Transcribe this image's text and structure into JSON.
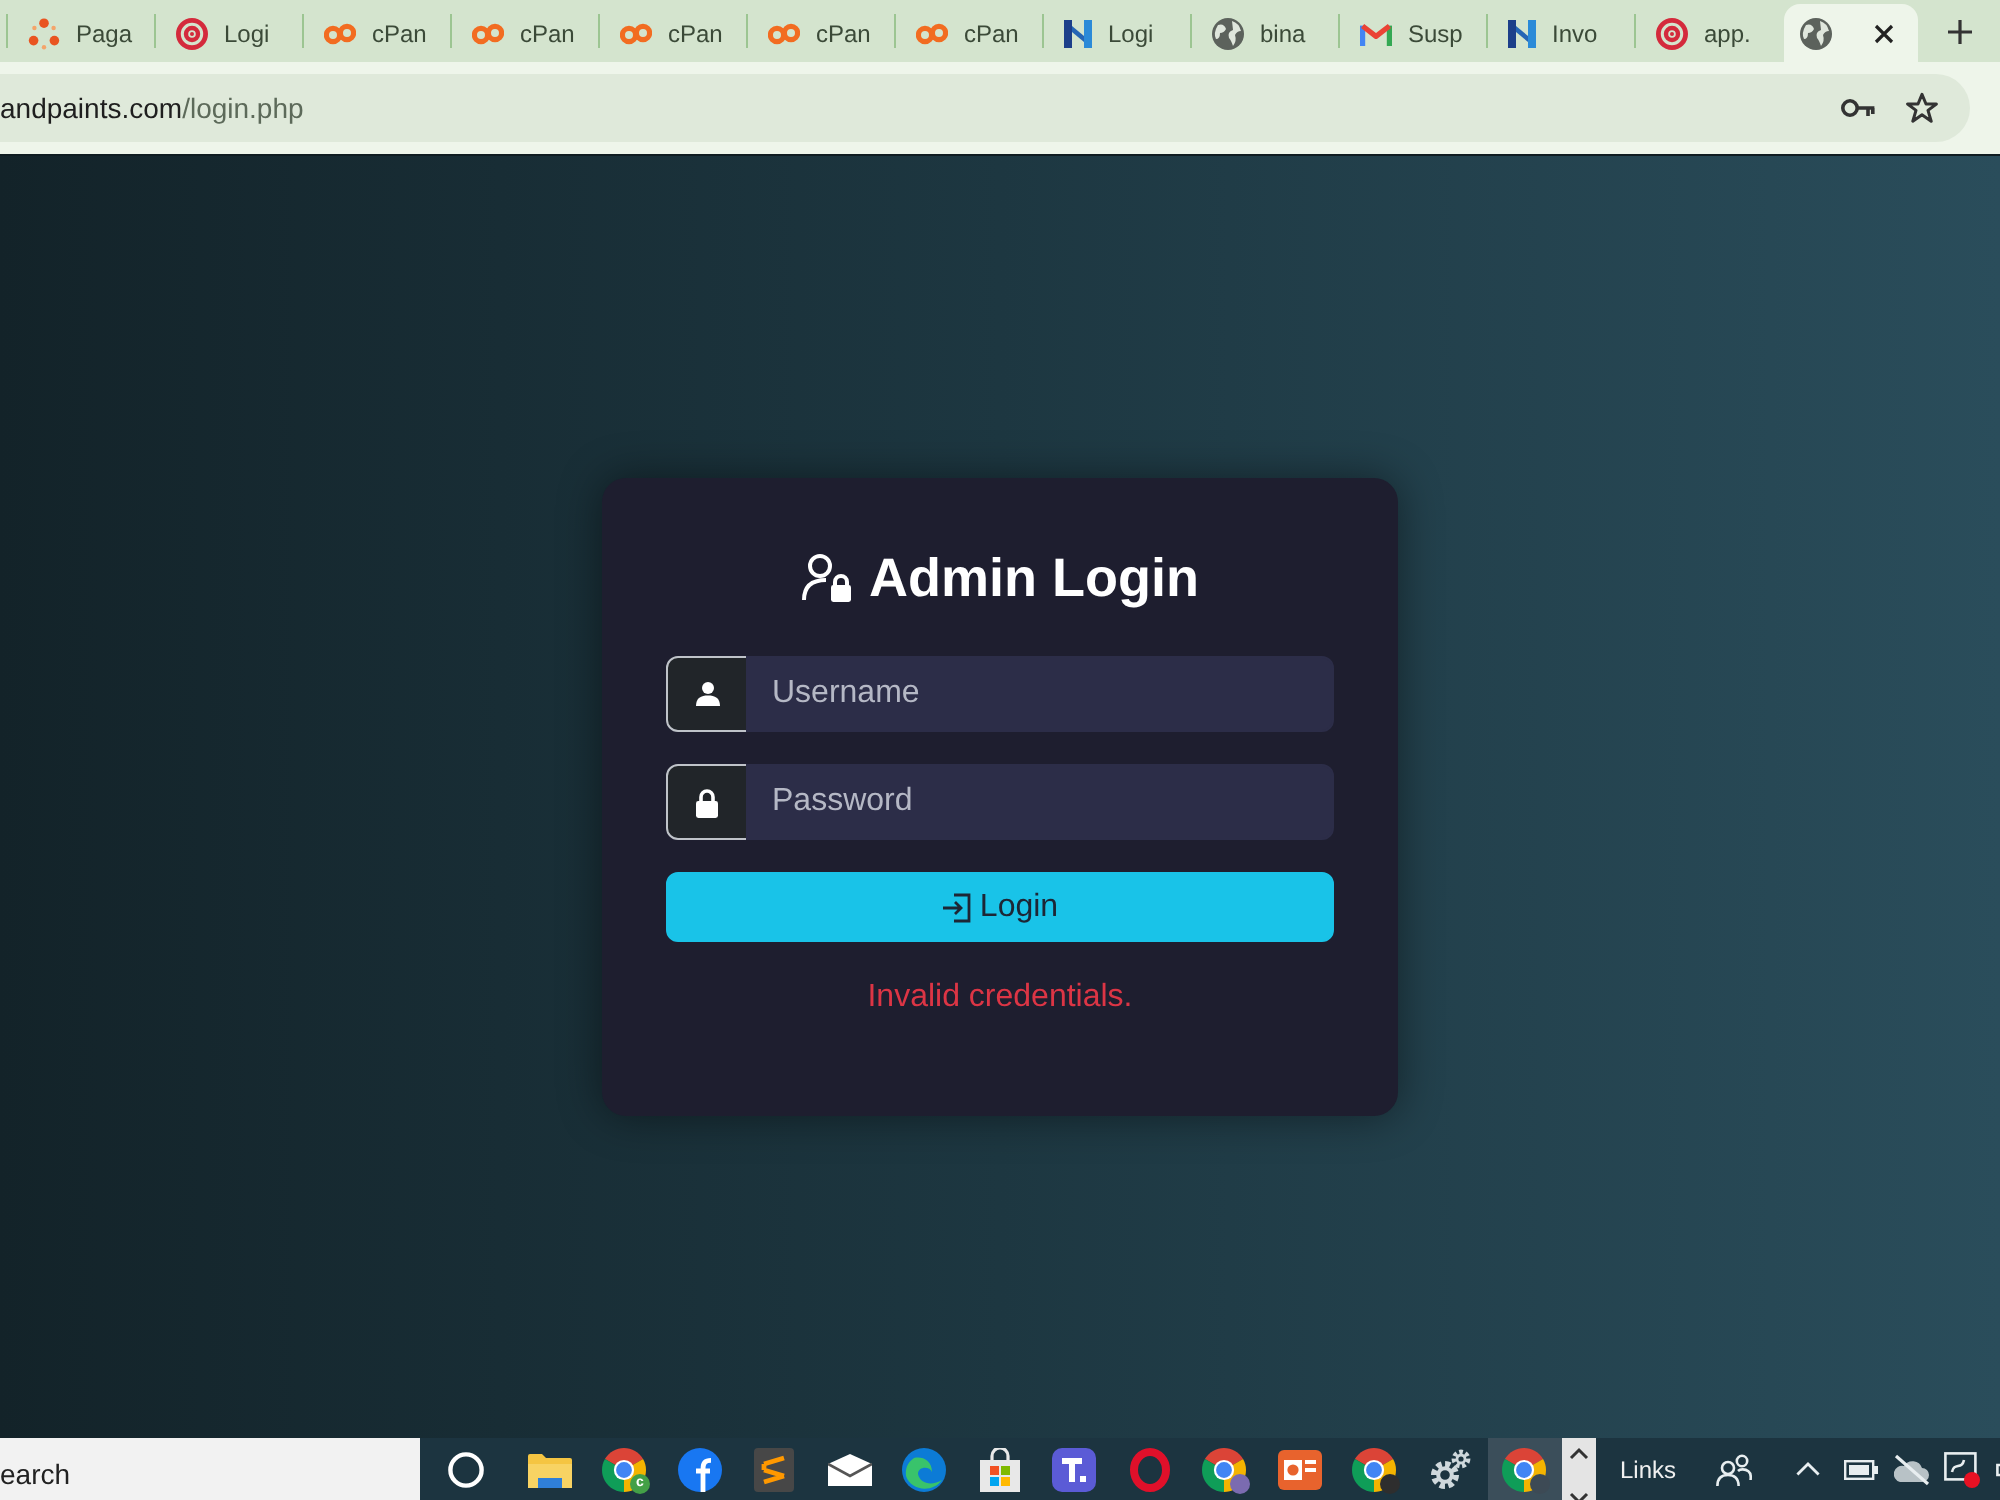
{
  "browser": {
    "tabs": [
      {
        "kind": "dots",
        "title": "Paga",
        "selected": false
      },
      {
        "kind": "target",
        "title": "Logi",
        "selected": false
      },
      {
        "kind": "rings",
        "title": "cPan",
        "selected": false
      },
      {
        "kind": "rings",
        "title": "cPan",
        "selected": false
      },
      {
        "kind": "rings",
        "title": "cPan",
        "selected": false
      },
      {
        "kind": "rings",
        "title": "cPan",
        "selected": false
      },
      {
        "kind": "rings",
        "title": "cPan",
        "selected": false
      },
      {
        "kind": "bars",
        "title": "Logi",
        "selected": false
      },
      {
        "kind": "globe",
        "title": "bina",
        "selected": false
      },
      {
        "kind": "mail",
        "title": "Susp",
        "selected": false
      },
      {
        "kind": "bars",
        "title": "Invo",
        "selected": false
      },
      {
        "kind": "target",
        "title": "app.",
        "selected": false
      },
      {
        "kind": "globe",
        "selected": true
      }
    ],
    "address": {
      "host": "andpaints.com",
      "path": "/login.php"
    }
  },
  "login": {
    "title": "Admin Login",
    "fields": [
      {
        "kind": "username",
        "placeholder": "Username"
      },
      {
        "kind": "password",
        "placeholder": "Password"
      }
    ],
    "button": "Login",
    "error": "Invalid credentials."
  },
  "taskbar": {
    "search": {
      "placeholder": "earch"
    },
    "apps": [
      {
        "kind": "ring",
        "selected": false
      },
      {
        "kind": "folder",
        "selected": false
      },
      {
        "kind": "browser",
        "selected": false,
        "badge": {
          "color": "#43a047",
          "label": "c"
        }
      },
      {
        "kind": "social",
        "selected": false
      },
      {
        "kind": "editor",
        "selected": false
      },
      {
        "kind": "envelope",
        "selected": false
      },
      {
        "kind": "wave",
        "selected": false
      },
      {
        "kind": "bag",
        "selected": false
      },
      {
        "kind": "tile",
        "selected": false
      },
      {
        "kind": "oval",
        "selected": false
      },
      {
        "kind": "browser",
        "selected": false,
        "badge": {
          "color": "#7b6bb0"
        }
      },
      {
        "kind": "slides",
        "selected": false
      },
      {
        "kind": "browser",
        "selected": false,
        "badge": {
          "color": "#2e2e2e"
        }
      },
      {
        "kind": "gears",
        "selected": false
      },
      {
        "kind": "browser",
        "selected": true,
        "badge": {
          "color": "#3d4a55"
        }
      }
    ],
    "links": "Links"
  }
}
